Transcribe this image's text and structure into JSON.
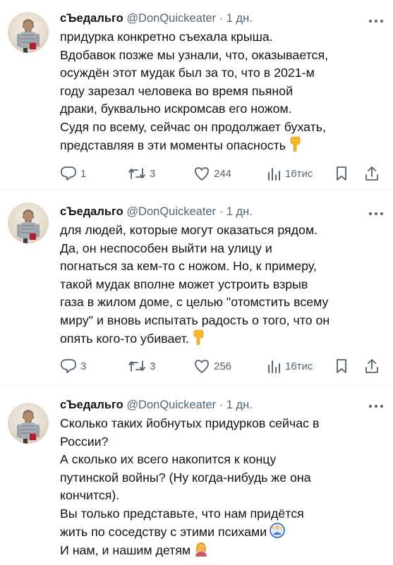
{
  "tweets": [
    {
      "author": "сЪедальго",
      "handle": "@DonQuickeater",
      "time": "· 1 дн.",
      "lines": [
        "придурка конкретно съехала крыша.",
        "Вдобавок позже мы узнали, что, оказывается,",
        "осуждён этот мудак был за то, что в 2021-м",
        "году зарезал человека во время пьяной",
        "драки, буквально искромсав его ножом.",
        "Судя по всему, сейчас он продолжает бухать,",
        "представляя в эти моменты опасность"
      ],
      "end_emoji": "point-down-icon",
      "stats": {
        "replies": "1",
        "reposts": "3",
        "likes": "244",
        "views": "16тис"
      }
    },
    {
      "author": "сЪедальго",
      "handle": "@DonQuickeater",
      "time": "· 1 дн.",
      "lines": [
        "для людей, которые могут оказаться рядом.",
        "Да, он неспособен выйти на улицу и",
        "погнаться за кем-то с ножом. Но, к примеру,",
        "такой мудак вполне может устроить взрыв",
        "газа в жилом доме, с целью \"отомстить всему",
        "миру\" и вновь испытать радость о того, что он",
        "опять кого-то убивает."
      ],
      "end_emoji": "point-down-icon",
      "stats": {
        "replies": "3",
        "reposts": "3",
        "likes": "256",
        "views": "16тис"
      }
    },
    {
      "author": "сЪедальго",
      "handle": "@DonQuickeater",
      "time": "· 1 дн.",
      "lines": [
        "Сколько таких йобнутых придурков сейчас в",
        "России?",
        "А сколько их всего накопится к концу",
        "путинской войны? (Ну когда-нибудь же она",
        "кончится).",
        "Вы только представьте, что нам придётся",
        "жить по соседству с этими психами",
        "И нам, и нашим детям"
      ]
    }
  ]
}
